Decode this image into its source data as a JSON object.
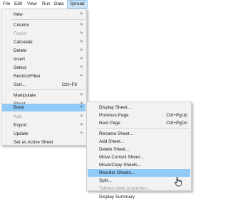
{
  "menubar": {
    "items": [
      "File",
      "Edit",
      "View",
      "Run",
      "Data",
      "Spread"
    ]
  },
  "spread_menu": {
    "items": [
      {
        "label": "New",
        "submenu": true,
        "disabled": false
      },
      {
        "label": "Column",
        "submenu": true,
        "disabled": false
      },
      {
        "label": "Factor",
        "submenu": true,
        "disabled": true
      },
      {
        "label": "Calculate",
        "submenu": true,
        "disabled": false
      },
      {
        "label": "Delete",
        "submenu": true,
        "disabled": false
      },
      {
        "label": "Insert",
        "submenu": true,
        "disabled": false
      },
      {
        "label": "Select",
        "submenu": true,
        "disabled": false
      },
      {
        "label": "Restrict/Filter",
        "submenu": true,
        "disabled": false
      },
      {
        "label": "Sort...",
        "shortcut": "Ctrl+F9",
        "disabled": false
      },
      {
        "label": "Manipulate",
        "submenu": true,
        "disabled": false
      },
      {
        "label": "Sheet",
        "submenu": true,
        "disabled": false
      },
      {
        "label": "Book",
        "submenu": true,
        "disabled": false,
        "active": true
      },
      {
        "label": "Add",
        "submenu": true,
        "disabled": true
      },
      {
        "label": "Export",
        "submenu": true,
        "disabled": false
      },
      {
        "label": "Update",
        "submenu": true,
        "disabled": false
      },
      {
        "label": "Set as Active Sheet",
        "disabled": false
      }
    ]
  },
  "book_submenu": {
    "items": [
      {
        "label": "Display Sheet...",
        "disabled": false
      },
      {
        "label": "Previous Page",
        "shortcut": "Ctrl+PgUp",
        "disabled": false
      },
      {
        "label": "Next Page",
        "shortcut": "Ctrl+PgDn",
        "disabled": false
      },
      {
        "label": "Rename Sheet...",
        "disabled": false
      },
      {
        "label": "Add Sheet...",
        "disabled": false
      },
      {
        "label": "Delete Sheet...",
        "disabled": false
      },
      {
        "label": "Move Current Sheet...",
        "disabled": false
      },
      {
        "label": "Move/Copy Sheets...",
        "disabled": false
      },
      {
        "label": "Reorder Sheets...",
        "disabled": false,
        "highlighted": true
      },
      {
        "label": "Split...",
        "disabled": false
      },
      {
        "label": "Tabbed-table properties...",
        "disabled": true
      },
      {
        "label": "Display Summary",
        "disabled": false
      }
    ]
  },
  "colors": {
    "menu_bg": "#f2f2f2",
    "highlight": "#91c9f7",
    "menubar_active": "#cce4f7",
    "disabled_text": "#9a9a9a"
  }
}
